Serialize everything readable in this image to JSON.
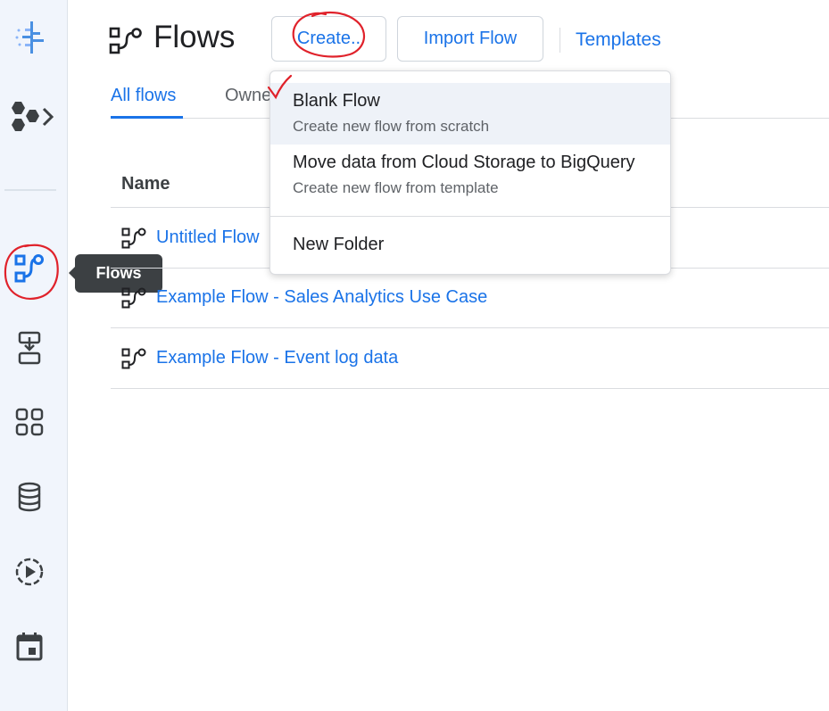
{
  "page": {
    "title": "Flows"
  },
  "toolbar": {
    "create_label": "Create..",
    "import_label": "Import Flow",
    "templates_label": "Templates"
  },
  "tabs": [
    {
      "label": "All flows"
    },
    {
      "label": "Owne"
    }
  ],
  "table": {
    "column_name": "Name",
    "rows": [
      {
        "name": "Untitled Flow"
      },
      {
        "name": "Example Flow - Sales Analytics Use Case"
      },
      {
        "name": "Example Flow - Event log data"
      }
    ]
  },
  "menu": {
    "items": [
      {
        "title": "Blank Flow",
        "subtitle": "Create new flow from scratch"
      },
      {
        "title": "Move data from Cloud Storage to BigQuery",
        "subtitle": "Create new flow from template"
      }
    ],
    "folder_label": "New Folder"
  },
  "sidebar": {
    "tooltip": "Flows"
  },
  "colors": {
    "accent": "#1a73e8",
    "annotation": "#e0222b",
    "sidebar_bg": "#f1f5fc"
  }
}
